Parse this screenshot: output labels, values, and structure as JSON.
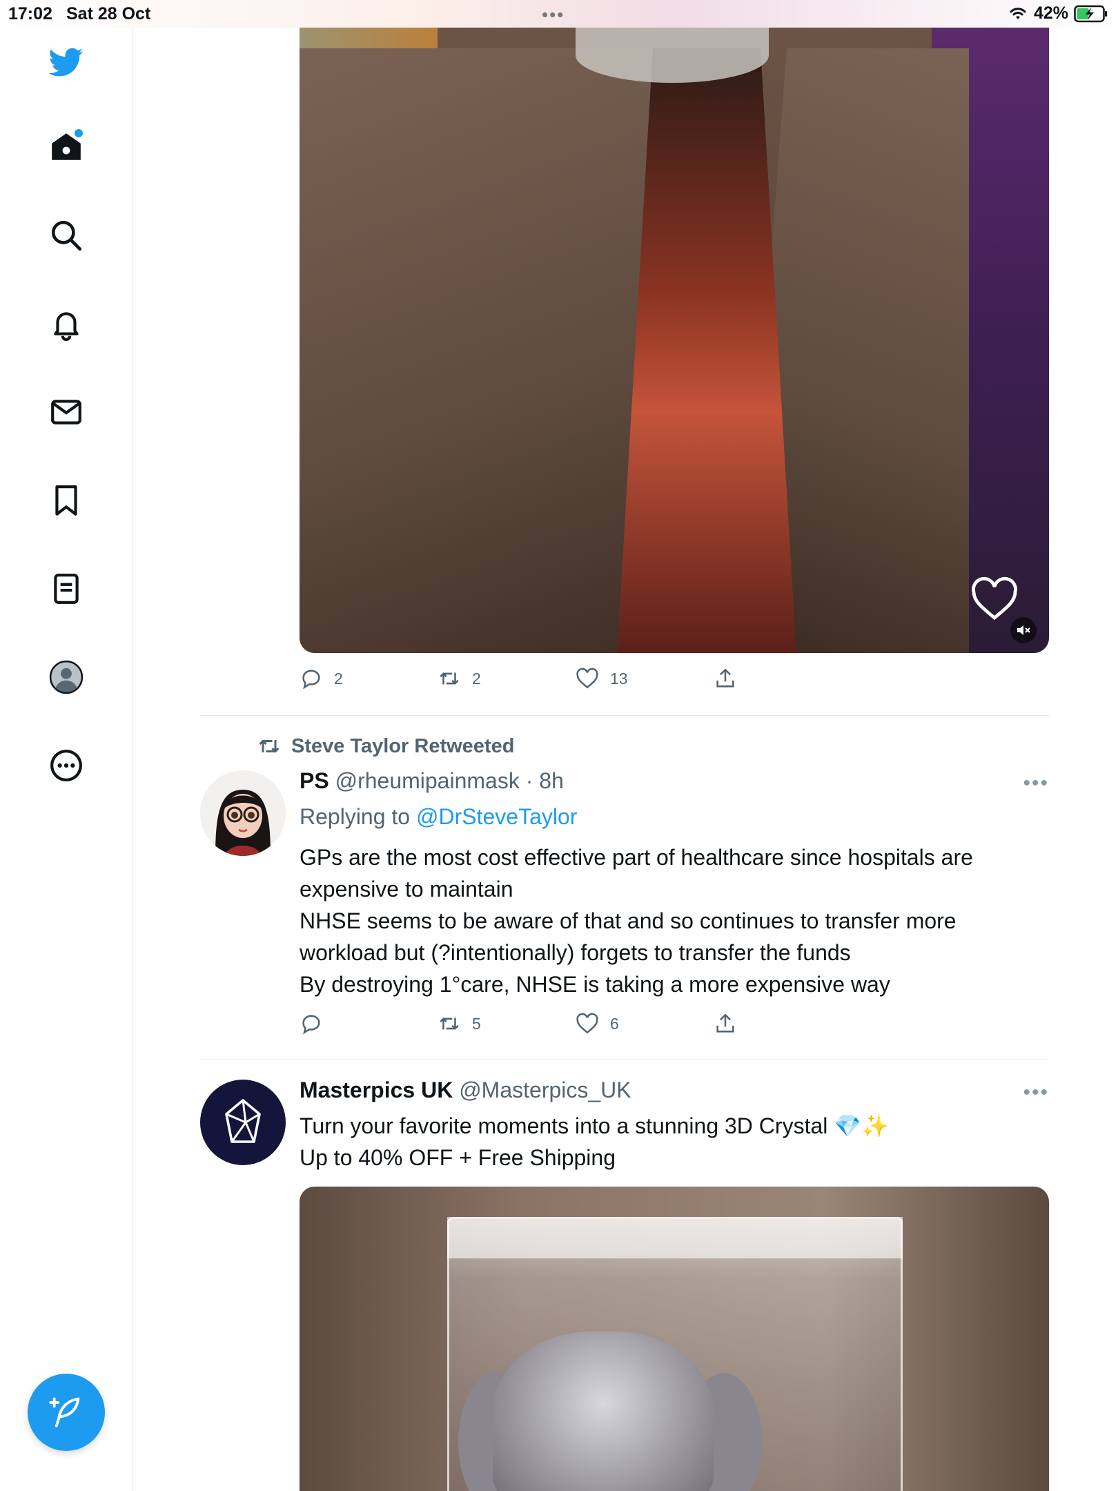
{
  "status_bar": {
    "time": "17:02",
    "date": "Sat 28 Oct",
    "battery": "42%"
  },
  "sidebar": {
    "items": [
      {
        "icon": "twitter-logo-icon"
      },
      {
        "icon": "home-icon"
      },
      {
        "icon": "search-icon"
      },
      {
        "icon": "notifications-bell-icon"
      },
      {
        "icon": "messages-envelope-icon"
      },
      {
        "icon": "bookmark-icon"
      },
      {
        "icon": "lists-icon"
      },
      {
        "icon": "profile-avatar-icon"
      },
      {
        "icon": "more-icon"
      }
    ],
    "compose_icon": "compose-feather-icon"
  },
  "colors": {
    "accent": "#1d9bf0",
    "text": "#0f1419",
    "muted": "#536471"
  },
  "tweet1": {
    "replies": "2",
    "retweets": "2",
    "likes": "13"
  },
  "tweet2": {
    "retweeted_by": "Steve Taylor Retweeted",
    "name": "PS",
    "handle_time": "@rheumipainmask · 8h",
    "replying_label": "Replying to",
    "replying_to": "@DrSteveTaylor",
    "lines": [
      "GPs are the most cost effective part of healthcare since hospitals are",
      "expensive to maintain",
      "NHSE seems to be aware of that and so continues to transfer more",
      "workload but (?intentionally) forgets to transfer the funds",
      "By destroying 1°care, NHSE is taking a more expensive way"
    ],
    "retweets": "5",
    "likes": "6"
  },
  "tweet3": {
    "name": "Masterpics UK",
    "handle": "@Masterpics_UK",
    "line1": "Turn your favorite moments into a stunning 3D Crystal 💎✨",
    "line2": "Up to 40% OFF + Free Shipping"
  }
}
